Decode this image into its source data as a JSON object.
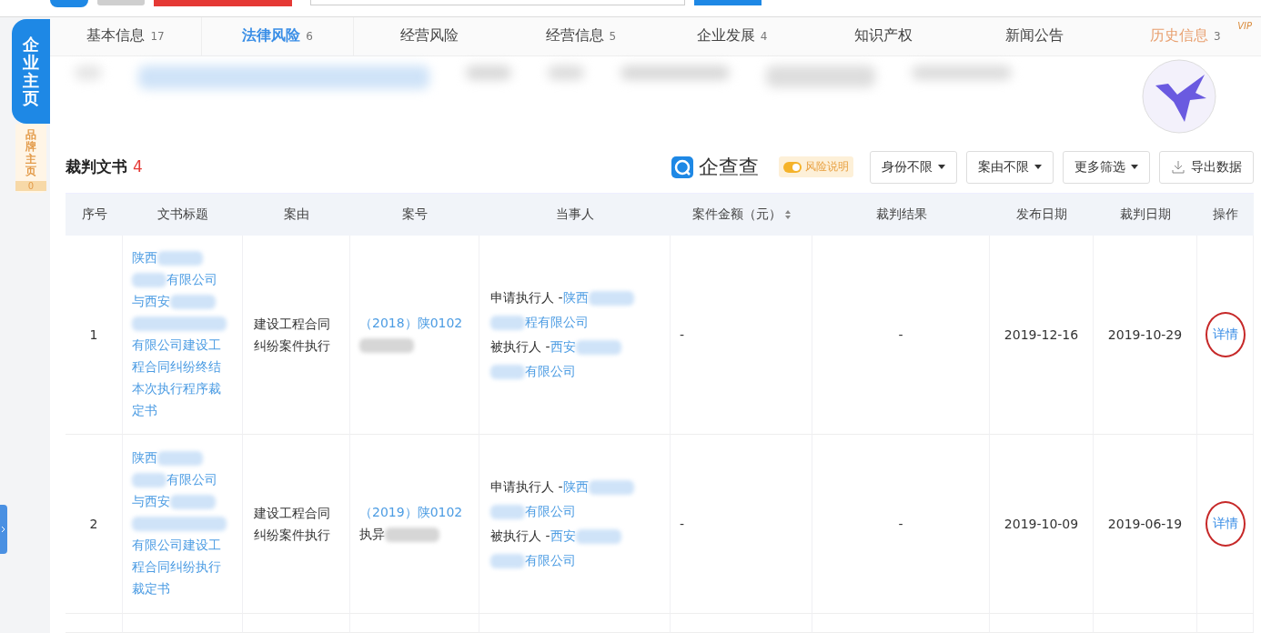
{
  "sidebar": {
    "items": [
      {
        "label": "企业主页",
        "selected": true
      },
      {
        "label": "品牌主页",
        "count": "0",
        "selected": false
      }
    ]
  },
  "tabs": [
    {
      "label": "基本信息",
      "count": "17",
      "selected": false
    },
    {
      "label": "法律风险",
      "count": "6",
      "selected": true
    },
    {
      "label": "经营风险",
      "selected": false
    },
    {
      "label": "经营信息",
      "count": "5",
      "selected": false
    },
    {
      "label": "企业发展",
      "count": "4",
      "selected": false
    },
    {
      "label": "知识产权",
      "selected": false
    },
    {
      "label": "新闻公告",
      "selected": false
    },
    {
      "label": "历史信息",
      "count": "3",
      "badge": "VIP",
      "selected": false
    }
  ],
  "section": {
    "title": "裁判文书",
    "count": "4",
    "brand": "企查查",
    "risk_note": "风险说明",
    "filters": [
      "身份不限",
      "案由不限",
      "更多筛选"
    ],
    "export": "导出数据"
  },
  "table": {
    "columns": [
      {
        "label": "序号"
      },
      {
        "label": "文书标题"
      },
      {
        "label": "案由"
      },
      {
        "label": "案号"
      },
      {
        "label": "当事人"
      },
      {
        "label": "案件金额（元）",
        "sortable": true
      },
      {
        "label": "裁判结果"
      },
      {
        "label": "发布日期"
      },
      {
        "label": "裁判日期"
      },
      {
        "label": "操作"
      }
    ],
    "rows": [
      {
        "index": "1",
        "title": [
          [
            {
              "kind": "text",
              "text": "陕西"
            },
            {
              "kind": "blur"
            }
          ],
          [
            {
              "kind": "blur"
            },
            {
              "kind": "text",
              "text": "有限公司"
            }
          ],
          [
            {
              "kind": "text",
              "text": "与西安"
            },
            {
              "kind": "blur"
            }
          ],
          [
            {
              "kind": "blur"
            }
          ],
          [
            {
              "kind": "text",
              "text": "有限公司建设工"
            }
          ],
          [
            {
              "kind": "text",
              "text": "程合同纠纷终结"
            }
          ],
          [
            {
              "kind": "text",
              "text": "本次执行程序裁"
            }
          ],
          [
            {
              "kind": "text",
              "text": "定书"
            }
          ]
        ],
        "cause": "建设工程合同纠纷案件执行",
        "case_no": [
          [
            {
              "kind": "text",
              "text": "（2018）陕0102"
            }
          ],
          [
            {
              "kind": "blur"
            }
          ]
        ],
        "parties": [
          [
            {
              "kind": "label",
              "text": "申请执行人 - "
            },
            {
              "kind": "text",
              "text": "陕西"
            },
            {
              "kind": "blur"
            }
          ],
          [
            {
              "kind": "blur"
            },
            {
              "kind": "text",
              "text": "程有限公司"
            }
          ],
          [
            {
              "kind": "label",
              "text": "被执行人 - "
            },
            {
              "kind": "text",
              "text": "西安"
            },
            {
              "kind": "blur"
            }
          ],
          [
            {
              "kind": "blur"
            },
            {
              "kind": "text",
              "text": "有限公司"
            }
          ]
        ],
        "amount": "-",
        "result": "-",
        "published": "2019-12-16",
        "judged": "2019-10-29",
        "action": "详情",
        "circled": true
      },
      {
        "index": "2",
        "title": [
          [
            {
              "kind": "text",
              "text": "陕西"
            },
            {
              "kind": "blur"
            }
          ],
          [
            {
              "kind": "blur"
            },
            {
              "kind": "text",
              "text": "有限公司"
            }
          ],
          [
            {
              "kind": "text",
              "text": "与西安"
            },
            {
              "kind": "blur"
            }
          ],
          [
            {
              "kind": "blur"
            }
          ],
          [
            {
              "kind": "text",
              "text": "有限公司建设工"
            }
          ],
          [
            {
              "kind": "text",
              "text": "程合同纠纷执行"
            }
          ],
          [
            {
              "kind": "text",
              "text": "裁定书"
            }
          ]
        ],
        "cause": "建设工程合同纠纷案件执行",
        "case_no": [
          [
            {
              "kind": "text",
              "text": "（2019）陕0102"
            }
          ],
          [
            {
              "kind": "label",
              "text": "执异"
            },
            {
              "kind": "blur"
            }
          ]
        ],
        "parties": [
          [
            {
              "kind": "label",
              "text": "申请执行人 - "
            },
            {
              "kind": "text",
              "text": "陕西"
            },
            {
              "kind": "blur"
            }
          ],
          [
            {
              "kind": "blur"
            },
            {
              "kind": "text",
              "text": "有限公司"
            }
          ],
          [
            {
              "kind": "label",
              "text": "被执行人 - "
            },
            {
              "kind": "text",
              "text": "西安"
            },
            {
              "kind": "blur"
            }
          ],
          [
            {
              "kind": "blur"
            },
            {
              "kind": "text",
              "text": "有限公司"
            }
          ]
        ],
        "amount": "-",
        "result": "-",
        "published": "2019-10-09",
        "judged": "2019-06-19",
        "action": "详情",
        "circled": true
      }
    ]
  }
}
